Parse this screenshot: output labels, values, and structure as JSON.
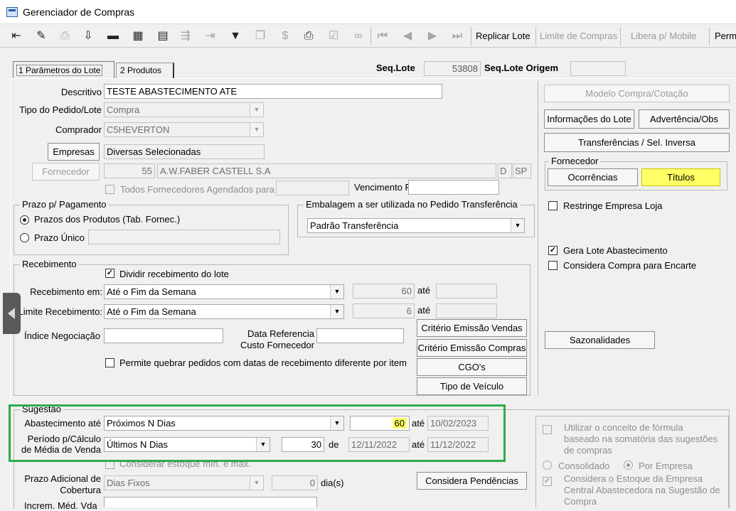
{
  "window": {
    "title": "Gerenciador de Compras"
  },
  "toolbar": {
    "icons": [
      "exit-icon",
      "edit-icon",
      "print-preview-icon",
      "save-icon",
      "delete-icon",
      "grid-icon",
      "clipboard-icon",
      "step-icon",
      "goto-icon",
      "filter-icon",
      "copy-icon",
      "price-icon",
      "printer-icon",
      "report-icon",
      "binoculars-icon",
      "first-icon",
      "prev-icon",
      "next-icon",
      "last-icon"
    ],
    "replicar_lote": "Replicar Lote",
    "limite_compras": "Limite de Compras",
    "libera_mobile": "Libera p/ Mobile",
    "perm": "Perm"
  },
  "tabs": [
    {
      "label": "1 Parâmetros do Lote"
    },
    {
      "label": "2 Produtos"
    }
  ],
  "header": {
    "seq_lote_label": "Seq.Lote",
    "seq_lote_value": "53808",
    "seq_origem_label": "Seq.Lote Origem",
    "seq_origem_value": ""
  },
  "form": {
    "descritivo_label": "Descritivo",
    "descritivo_value": "TESTE ABASTECIMENTO ATE",
    "tipo_label": "Tipo do Pedido/Lote",
    "tipo_value": "Compra",
    "comprador_label": "Comprador",
    "comprador_value": "C5HEVERTON",
    "empresas_button": "Empresas",
    "empresas_value": "Diversas Selecionadas",
    "fornecedor_button": "Fornecedor",
    "fornecedor_code": "55",
    "fornecedor_name": "A.W.FABER CASTELL S.A",
    "fornecedor_d": "D",
    "fornecedor_uf": "SP",
    "todos_fornecedores_label": "Todos Fornecedores Agendados para",
    "todos_fornecedores_value": "",
    "vencimento_label": "Vencimento Fixo",
    "vencimento_value": ""
  },
  "prazo": {
    "title": "Prazo p/ Pagamento",
    "opt1": "Prazos dos Produtos (Tab. Fornec.)",
    "opt2": "Prazo Único",
    "prazo_unico_value": ""
  },
  "embalagem": {
    "title": "Embalagem a ser utilizada no Pedido Transferência",
    "value": "Padrão Transferência"
  },
  "recebimento": {
    "title": "Recebimento",
    "dividir_label": "Dividir recebimento do lote",
    "receb_em_label": "Recebimento em:",
    "receb_em_value": "Até o Fim da Semana",
    "receb_em_num": "60",
    "ate1": "até",
    "ate1_value": "",
    "limite_label": "Limite Recebimento:",
    "limite_value": "Até o Fim da Semana",
    "limite_num": "6",
    "ate2": "até",
    "ate2_value": "",
    "indice_label": "Índice Negociação",
    "indice_value": "",
    "data_ref_label1": "Data Referencia",
    "data_ref_label2": "Custo Fornecedor",
    "data_ref_value": "",
    "permite_label": "Permite quebrar pedidos com datas de recebimento diferente por item",
    "criterio_vendas": "Critério Emissão Vendas",
    "criterio_compras": "Critério Emissão Compras",
    "cgo": "CGO's",
    "tipo_veiculo": "Tipo de Veículo"
  },
  "sugestao": {
    "title": "Sugestão",
    "abast_label": "Abastecimento até",
    "abast_value": "Próximos N Dias",
    "abast_num": "60",
    "abast_ate": "até",
    "abast_date": "10/02/2023",
    "periodo_label1": "Período p/Cálculo",
    "periodo_label2": "de Média de Venda",
    "periodo_value": "Últimos N Dias",
    "periodo_num": "30",
    "periodo_de": "de",
    "periodo_from": "12/11/2022",
    "periodo_ate": "até",
    "periodo_to": "11/12/2022",
    "considerar_label": "Considerar estoque mín. e máx.",
    "prazo_adic_label1": "Prazo Adicional de",
    "prazo_adic_label2": "Cobertura",
    "prazo_adic_value": "Dias Fixos",
    "prazo_adic_num": "0",
    "prazo_adic_unit": "dia(s)",
    "considera_pend": "Considera Pendências",
    "increm_label": "Increm. Méd. Vda",
    "formula_label": "Utilizar o conceito de fórmula baseado na somatória das sugestões de compras",
    "consolidado": "Consolidado",
    "por_empresa": "Por Empresa",
    "considera_estoque": "Considera o Estoque da Empresa Central Abastecedora na Sugestão de Compra"
  },
  "right": {
    "modelo": "Modelo Compra/Cotação",
    "informacoes": "Informações do Lote",
    "advertencia": "Advertência/Obs",
    "transferencias": "Transferências / Sel. Inversa",
    "fornecedor_title": "Fornecedor",
    "ocorrencias": "Ocorrências",
    "titulos": "Títulos",
    "restringe": "Restringe Empresa Loja",
    "gera_lote": "Gera Lote Abastecimento",
    "considera_encarte": "Considera Compra para Encarte",
    "sazonalidades": "Sazonalidades"
  },
  "colors": {
    "highlight": "#ffff66",
    "sugestao_frame": "#2bad4a",
    "side_handle": "#5a5a5a"
  }
}
